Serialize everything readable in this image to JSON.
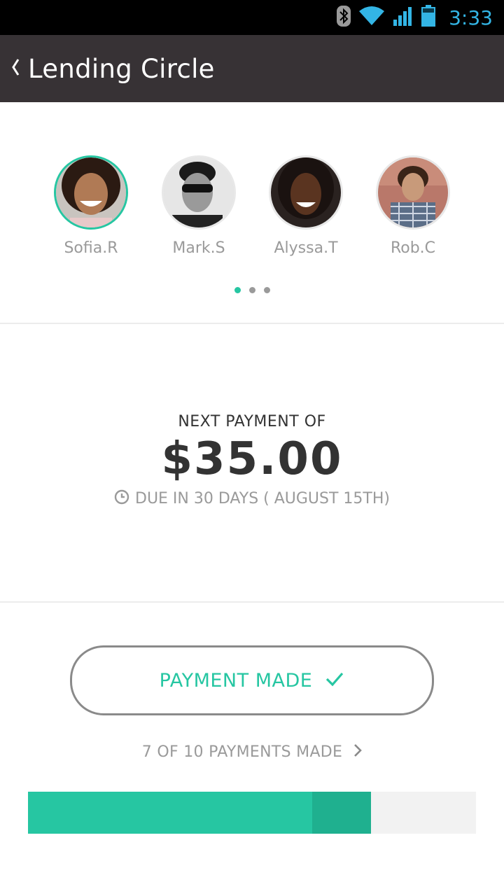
{
  "status_bar": {
    "time": "3:33",
    "icons": [
      "bluetooth-icon",
      "wifi-icon",
      "signal-icon",
      "battery-icon"
    ]
  },
  "app_bar": {
    "title": "Lending Circle",
    "back_icon": "chevron-left-icon"
  },
  "members": [
    {
      "name": "Sofia.R",
      "selected": true
    },
    {
      "name": "Mark.S",
      "selected": false
    },
    {
      "name": "Alyssa.T",
      "selected": false
    },
    {
      "name": "Rob.C",
      "selected": false
    }
  ],
  "pager": {
    "pages": 3,
    "current": 1
  },
  "payment": {
    "caption": "NEXT PAYMENT OF",
    "amount": "$35.00",
    "due": "DUE IN 30 DAYS ( AUGUST 15TH)",
    "due_icon": "clock-icon"
  },
  "action": {
    "label": "PAYMENT MADE",
    "icon": "check-icon"
  },
  "progress": {
    "summary": "7 OF 10 PAYMENTS MADE",
    "link_icon": "chevron-right-icon",
    "made": 7,
    "current": 1,
    "total": 10
  },
  "colors": {
    "accent": "#26c6a2",
    "accent_dark": "#1fb08f",
    "app_bar": "#373235",
    "status_time": "#33b5e5"
  }
}
